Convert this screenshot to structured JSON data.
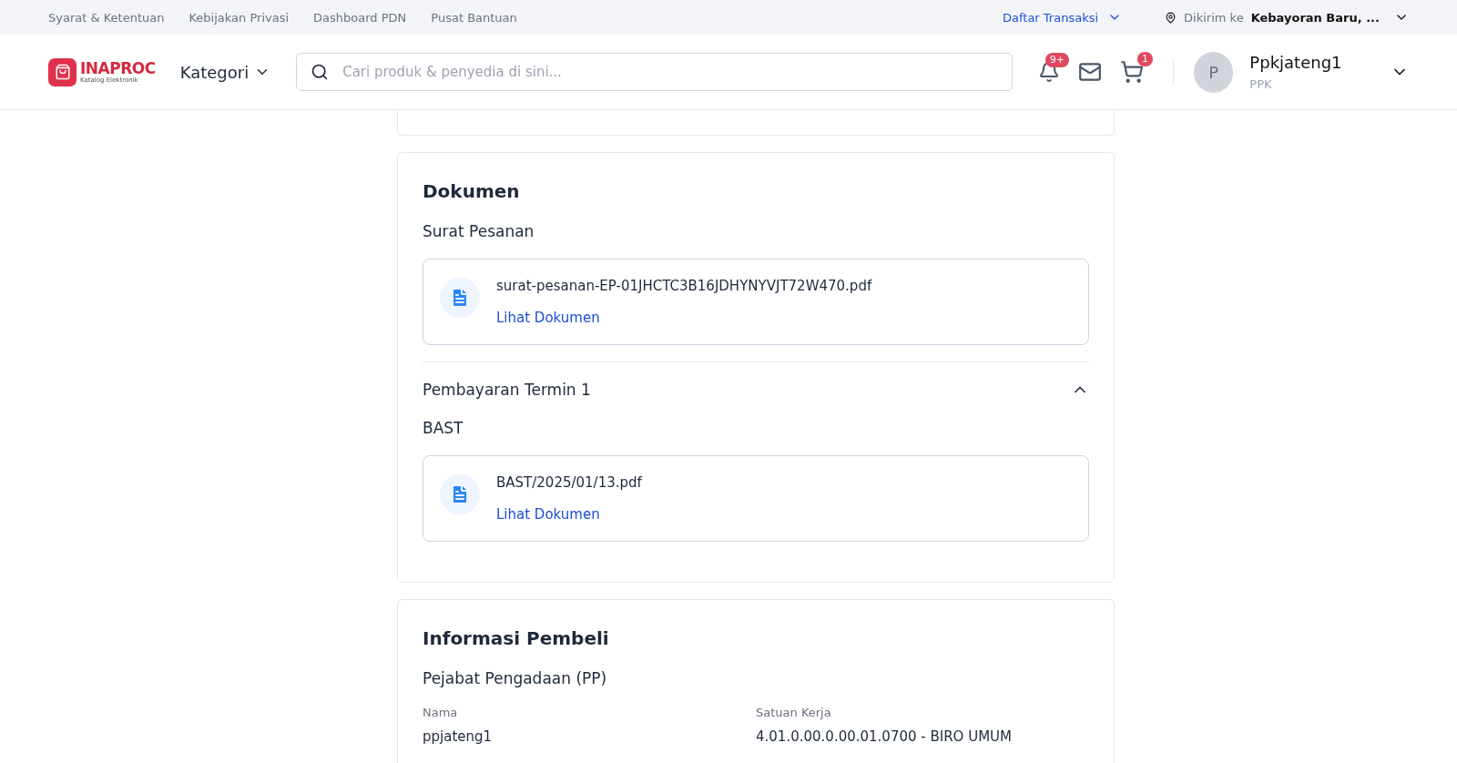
{
  "top_links": [
    "Syarat & Ketentuan",
    "Kebijakan Privasi",
    "Dashboard PDN",
    "Pusat Bantuan"
  ],
  "transactions_menu": {
    "label": "Daftar Transaksi"
  },
  "delivery": {
    "label": "Dikirim ke",
    "location": "Kebayoran Baru, ..."
  },
  "logo": {
    "name": "INAPROC",
    "subtitle": "Katalog Elektronik"
  },
  "category_menu": {
    "label": "Kategori"
  },
  "search": {
    "placeholder": "Cari produk & penyedia di sini..."
  },
  "notifications": {
    "badge": "9+"
  },
  "cart": {
    "badge": "1"
  },
  "user": {
    "initial": "P",
    "name": "Ppkjateng1",
    "role": "PPK"
  },
  "documents": {
    "title": "Dokumen",
    "sections": [
      {
        "kind": "plain",
        "title": "Surat Pesanan",
        "files": [
          {
            "name": "surat-pesanan-EP-01JHCTC3B16JDHYNYVJT72W470.pdf",
            "action": "Lihat Dokumen"
          }
        ]
      },
      {
        "kind": "collapsible",
        "title": "Pembayaran Termin 1",
        "expanded": true,
        "subtitle": "BAST",
        "files": [
          {
            "name": "BAST/2025/01/13.pdf",
            "action": "Lihat Dokumen"
          }
        ]
      }
    ]
  },
  "buyer": {
    "title": "Informasi Pembeli",
    "subtitle": "Pejabat Pengadaan (PP)",
    "fields": [
      {
        "label": "Nama",
        "value": "ppjateng1"
      },
      {
        "label": "Satuan Kerja",
        "value": "4.01.0.00.0.00.01.0700 - BIRO UMUM"
      }
    ]
  }
}
